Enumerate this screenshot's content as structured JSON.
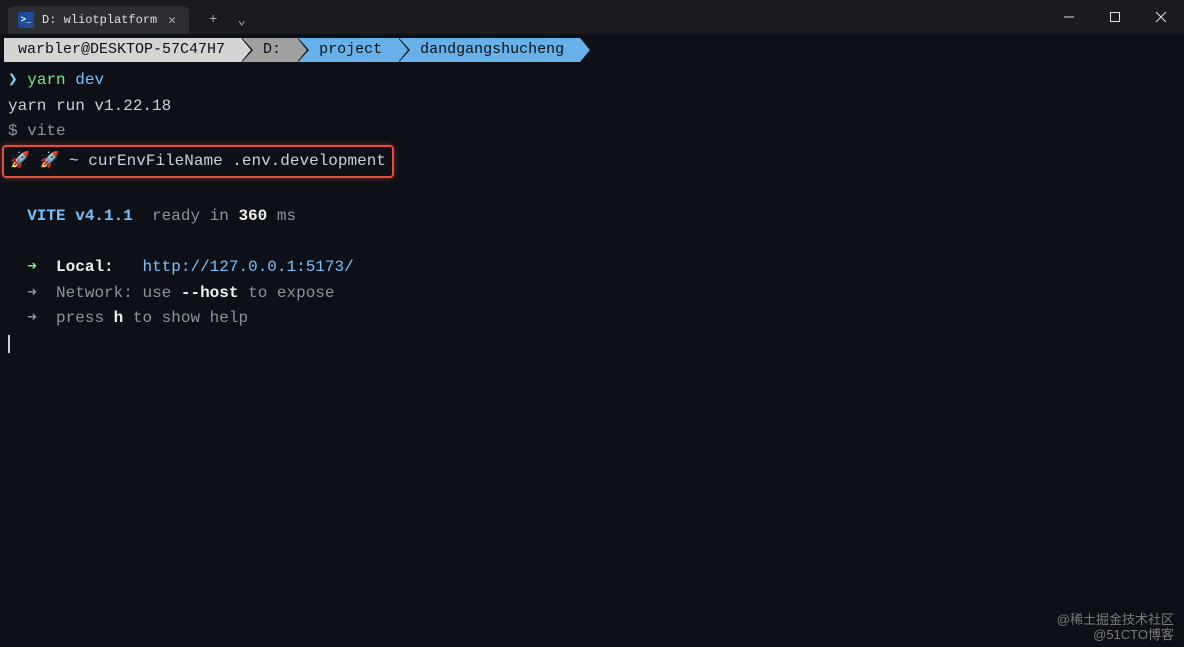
{
  "window": {
    "tab_title": "D: wliotplatform",
    "tab_icon_label": ">_"
  },
  "breadcrumb": {
    "host": "warbler@DESKTOP-57C47H7",
    "drive": "D:",
    "folder1": "project",
    "folder2": "dandgangshucheng"
  },
  "terminal": {
    "prompt_symbol": "❯",
    "cmd_yarn": "yarn",
    "cmd_dev": "dev",
    "yarn_run": "yarn run v1.22.18",
    "vite_line": "$ vite",
    "highlight": "🚀 🚀 ~ curEnvFileName .env.development",
    "vite_label": "VITE v4.1.1",
    "ready_prefix": "  ready in ",
    "ready_time": "360",
    "ready_suffix": " ms",
    "arrow": "➜",
    "local_label": "  Local:   ",
    "local_url": "http://127.0.0.1:5173/",
    "network_label": "  Network:",
    "network_use": " use ",
    "network_host": "--host",
    "network_expose": " to expose",
    "help_press": "  press ",
    "help_key": "h",
    "help_rest": " to show help"
  },
  "watermarks": {
    "line1": "@稀土掘金技术社区",
    "line2": "@51CTO博客"
  }
}
